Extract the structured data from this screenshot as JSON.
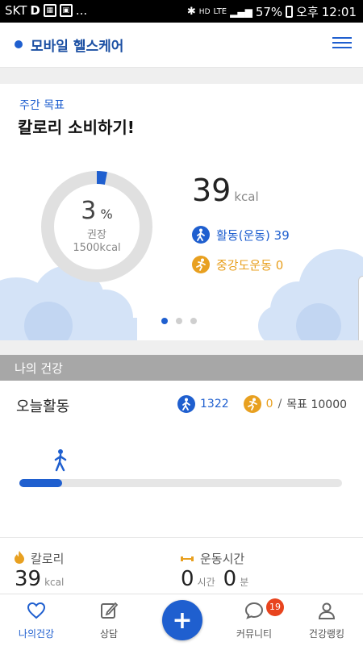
{
  "status_bar": {
    "carrier": "SKT",
    "left_icons": [
      "D",
      "bus-icon",
      "gallery-icon",
      "..."
    ],
    "network": "LTE",
    "battery": "57%",
    "ampm": "오후",
    "time": "12:01"
  },
  "header": {
    "title": "모바일 헬스케어"
  },
  "weekly_goal": {
    "label": "주간 목표",
    "title": "칼로리 소비하기!",
    "percent": "3",
    "percent_unit": "%",
    "percent_fraction": 0.03,
    "recommended_label": "권장",
    "recommended_value": "1500kcal",
    "kcal_value": "39",
    "kcal_unit": "kcal",
    "activity_label": "활동(운동) 39",
    "moderate_label": "중강도운동 0",
    "page_count": 3,
    "active_page": 0
  },
  "my_health": {
    "section_title": "나의 건강",
    "today_title": "오늘활동",
    "steps": "1322",
    "run_value": "0",
    "goal_sep": "/",
    "goal_text": "목표 10000",
    "progress_fraction": 0.1322,
    "calorie_label": "칼로리",
    "calorie_value": "39",
    "calorie_unit": "kcal",
    "exercise_label": "운동시간",
    "exercise_hours": "0",
    "exercise_hours_unit": "시간",
    "exercise_minutes": "0",
    "exercise_minutes_unit": "분"
  },
  "bottom_nav": {
    "items": [
      {
        "label": "나의건강",
        "icon": "heart-icon"
      },
      {
        "label": "상담",
        "icon": "edit-icon"
      },
      {
        "label": "커뮤니티",
        "icon": "chat-icon"
      },
      {
        "label": "건강랭킹",
        "icon": "person-icon"
      }
    ],
    "fab_symbol": "+",
    "community_badge": "19"
  },
  "colors": {
    "primary": "#1f5fcf",
    "accent_orange": "#e8a020",
    "badge_red": "#e8441e"
  }
}
